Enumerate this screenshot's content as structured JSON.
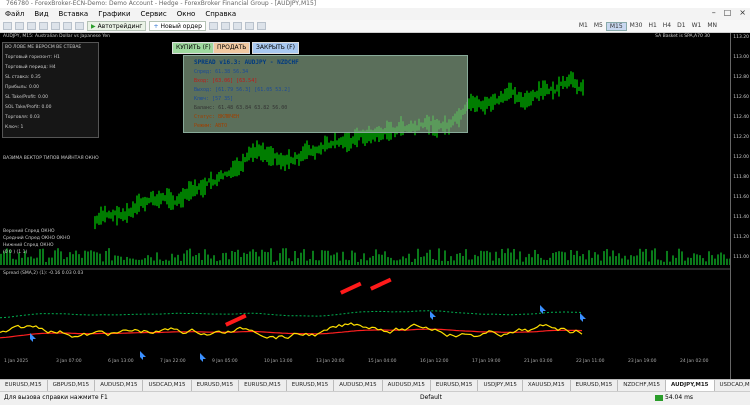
{
  "titlebar": {
    "text": "766780 - ForexBroker-ECN-Demo: Demo Account - Hedge - ForexBroker Financial Group - [AUDJPY,M15]"
  },
  "menu": {
    "items": [
      "Файл",
      "Вид",
      "Вставка",
      "Графики",
      "Сервис",
      "Окно",
      "Справка"
    ]
  },
  "toolbar": {
    "autotrade_label": "Автотрейдинг",
    "new_order_label": "Новый ордер",
    "timeframes": [
      "M1",
      "M5",
      "M15",
      "M30",
      "H1",
      "H4",
      "D1",
      "W1",
      "MN"
    ],
    "active_timeframe": "M15"
  },
  "chart": {
    "symbol_header": "AUDJPY, M15: Australian Dollar vs Japanese Yen",
    "buy_label": "КУПИТЬ (F)",
    "sell_label": "ПРОДАТЬ",
    "close_label": "ЗАКРЫТЬ (F)",
    "top_right_label": "SA Basket is SPA,A70 30",
    "left_panel_rows": [
      "ВО ЛОВЕ МЕ ВЕРОСМ ВЕ СТЕВАЕ",
      "Торговый горизонт: H1",
      "Торговый период: H4",
      "SL ставка: 0.35",
      "Прибыль: 0.00",
      "SL Take/Profit: 0.00",
      "SOL Take/Profit: 0.00",
      "Торговля: 0.03",
      "Ключ: 1"
    ],
    "spread_box": {
      "title": "SPREAD v16.3: AUDJPY - NZDCHF",
      "lines": [
        "Спред: 61.38 56.34",
        "Вход: [63.06] [63.54]",
        "Выход: [61.79 56.3] [61.05 53.2]",
        "Ключ: [57 35]",
        "Баланс: 61.48 63.84 63.82 56.00",
        "Статус: ВКЛЮЧЕН",
        "Режим: АВТО"
      ]
    },
    "indicator1_label": "ВАЗИМА ВЕКТОР ТИПОВ МАЙНТАЯ ОКНО",
    "indicator2_labels": [
      "Верхний Спред ОКНО",
      "Средний Спред ОКНО ОКНО",
      "Нижний Спред ОКНО",
      "(0 0 ) (1 1)"
    ],
    "indicator3_label": "Spread (SMA,2) (1): -0.16 0.03 0.03",
    "price_axis": [
      "113.20",
      "113.00",
      "112.80",
      "112.60",
      "112.40",
      "112.20",
      "112.00",
      "111.80",
      "111.60",
      "111.40",
      "111.20",
      "111.00"
    ],
    "date_axis": [
      "1 Jan 2025",
      "3 Jan 07:00",
      "6 Jan 13:00",
      "7 Jan 22:00",
      "9 Jan 05:00",
      "10 Jan 13:00",
      "13 Jan 20:00",
      "15 Jan 04:00",
      "16 Jan 12:00",
      "17 Jan 19:00",
      "21 Jan 03:00",
      "22 Jan 11:00",
      "23 Jan 19:00",
      "24 Jan 02:00"
    ]
  },
  "tabs": {
    "items": [
      "EURUSD,M15",
      "GBPUSD,M15",
      "AUDUSD,M15",
      "USDCAD,M15",
      "EURUSD,M15",
      "EURUSD,M15",
      "EURUSD,M15",
      "AUDUSD,M15",
      "AUDUSD,M15",
      "EURUSD,M15",
      "USDJPY,M15",
      "XAUUSD,M15",
      "EURUSD,M15",
      "NZDCHF,M15",
      "AUDJPY,M15",
      "USDCAD,M15",
      "AUDNZD,M15"
    ],
    "active": "AUDJPY,M15"
  },
  "status": {
    "help": "Для вызова справки нажмите F1",
    "profile": "Default",
    "connection": "54.04 ms"
  },
  "colors": {
    "candles": "#00d000",
    "spread_line": "#ffe000",
    "ma_red": "#ff2020",
    "ma_green": "#00b050",
    "arrow_blue": "#3a8fff"
  }
}
